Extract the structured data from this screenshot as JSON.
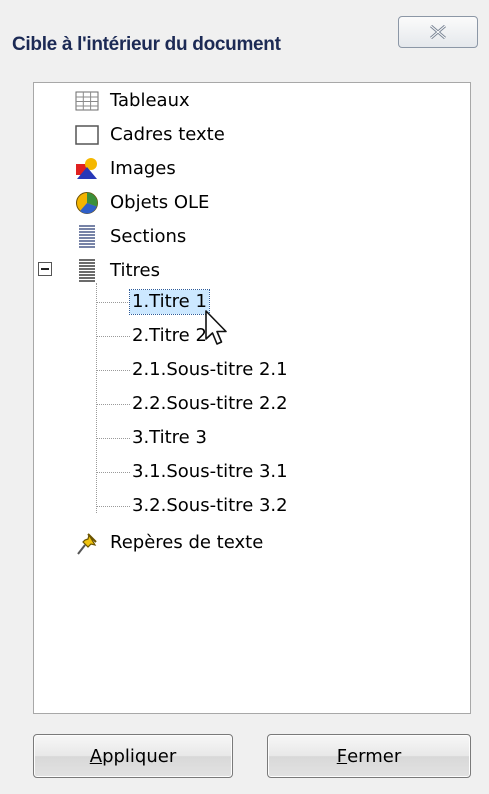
{
  "dialog": {
    "title": "Cible à l'intérieur du document"
  },
  "tree": {
    "items": [
      {
        "label": "Tableaux",
        "icon": "table-icon"
      },
      {
        "label": "Cadres texte",
        "icon": "frame-icon"
      },
      {
        "label": "Images",
        "icon": "images-icon"
      },
      {
        "label": "Objets OLE",
        "icon": "ole-object-icon"
      },
      {
        "label": "Sections",
        "icon": "sections-icon"
      },
      {
        "label": "Titres",
        "icon": "headings-icon",
        "expanded": true
      },
      {
        "label": "Repères de texte",
        "icon": "bookmark-pin-icon"
      }
    ],
    "headings": [
      {
        "label": "1.Titre 1",
        "selected": true
      },
      {
        "label": "2.Titre 2"
      },
      {
        "label": "2.1.Sous-titre 2.1"
      },
      {
        "label": "2.2.Sous-titre 2.2"
      },
      {
        "label": "3.Titre 3"
      },
      {
        "label": "3.1.Sous-titre 3.1"
      },
      {
        "label": "3.2.Sous-titre 3.2"
      }
    ]
  },
  "buttons": {
    "apply": {
      "first": "A",
      "rest": "ppliquer"
    },
    "close": {
      "first": "F",
      "rest": "ermer"
    }
  }
}
